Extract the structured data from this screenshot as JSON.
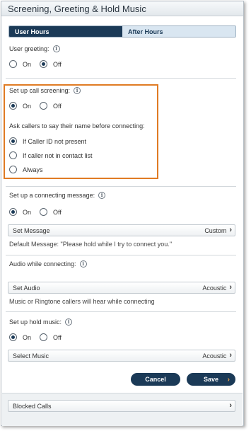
{
  "header": {
    "title": "Screening, Greeting & Hold Music"
  },
  "tabs": [
    {
      "label": "User Hours",
      "active": true
    },
    {
      "label": "After Hours",
      "active": false
    }
  ],
  "user_greeting": {
    "label": "User greeting:",
    "on_label": "On",
    "off_label": "Off",
    "selected": "Off"
  },
  "call_screening": {
    "label": "Set up call screening:",
    "on_label": "On",
    "off_label": "Off",
    "selected": "On",
    "ask_label": "Ask callers to say their name before connecting:",
    "options": [
      "If Caller ID not present",
      "If caller not in contact list",
      "Always"
    ],
    "selected_option": "If Caller ID not present"
  },
  "connecting_message": {
    "label": "Set up a connecting message:",
    "on_label": "On",
    "off_label": "Off",
    "selected": "On",
    "button_label": "Set Message",
    "button_value": "Custom",
    "default_text": "Default Message: \"Please hold while I try to connect you.\""
  },
  "audio_connecting": {
    "label": "Audio while connecting:",
    "button_label": "Set Audio",
    "button_value": "Acoustic",
    "note": "Music or Ringtone callers will hear while connecting"
  },
  "hold_music": {
    "label": "Set up hold music:",
    "on_label": "On",
    "off_label": "Off",
    "selected": "On",
    "button_label": "Select Music",
    "button_value": "Acoustic"
  },
  "actions": {
    "cancel_label": "Cancel",
    "save_label": "Save"
  },
  "blocked_calls": {
    "label": "Blocked Calls"
  },
  "colors": {
    "accent": "#1b3a57",
    "highlight": "#e07b24",
    "save_arrow": "#f0a34a"
  }
}
